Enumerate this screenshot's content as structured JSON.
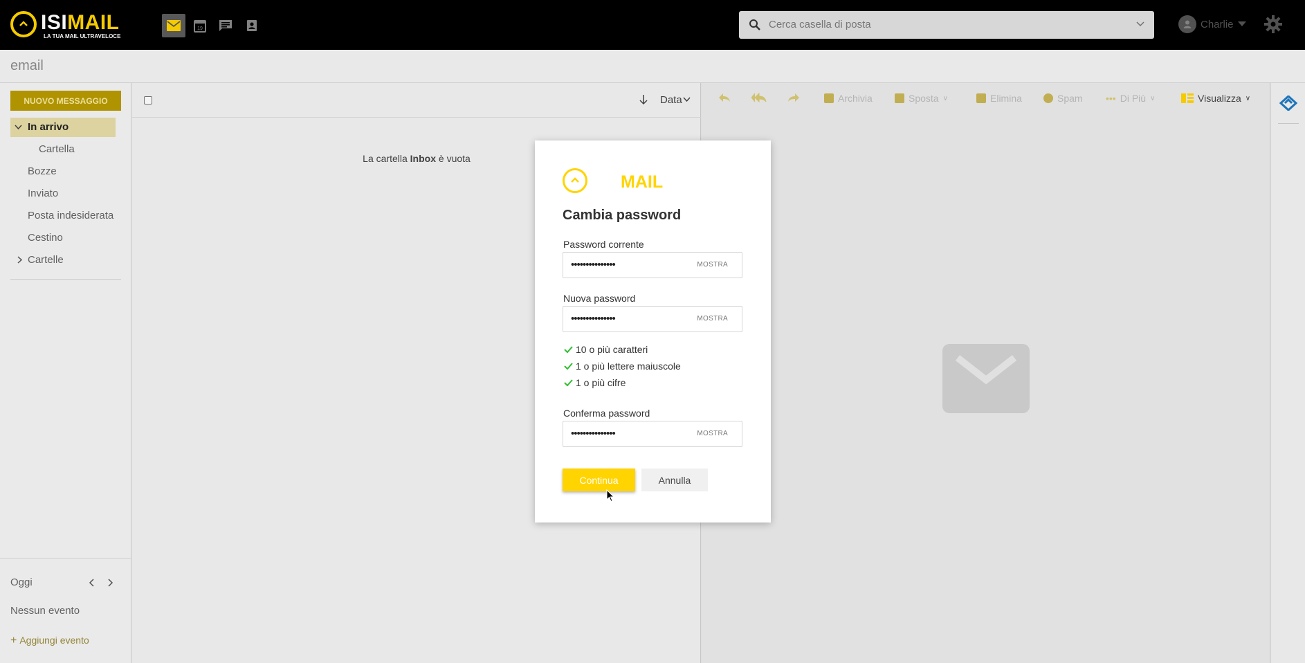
{
  "header": {
    "brand_prefix": "ISI",
    "brand_suffix": "MAIL",
    "tagline": "LA TUA MAIL ULTRAVELOCE",
    "apps": [
      "mail-icon",
      "calendar-icon",
      "chat-icon",
      "contacts-icon"
    ],
    "search": {
      "placeholder": "Cerca casella di posta"
    },
    "user_name": "Charlie"
  },
  "module": {
    "title": "email"
  },
  "sidebar": {
    "new_message_label": "NUOVO MESSAGGIO",
    "folders": [
      {
        "label": "In arrivo"
      },
      {
        "label": "Cartella"
      },
      {
        "label": "Bozze"
      },
      {
        "label": "Inviato"
      },
      {
        "label": "Posta indesiderata"
      },
      {
        "label": "Cestino"
      },
      {
        "label": "Cartelle"
      }
    ],
    "calendar": {
      "day_label": "Oggi",
      "no_events": "Nessun evento",
      "add_event": "Aggiungi evento"
    }
  },
  "list": {
    "sort_label": "Data",
    "empty_prefix": "La cartella ",
    "empty_folder": "Inbox",
    "empty_suffix": " è vuota"
  },
  "toolbar": {
    "archive": "Archivia",
    "move": "Sposta",
    "delete": "Elimina",
    "spam": "Spam",
    "more": "Di Più",
    "view": "Visualizza"
  },
  "modal": {
    "logo_text": "MAIL",
    "title": "Cambia password",
    "current_label": "Password corrente",
    "current_value": "•••••••••••••••",
    "new_label": "Nuova password",
    "new_value": "•••••••••••••••",
    "confirm_label": "Conferma password",
    "confirm_value": "•••••••••••••••",
    "show_label": "MOSTRA",
    "rules": [
      "10 o più caratteri",
      "1 o più lettere maiuscole",
      "1 o più cifre"
    ],
    "continue_label": "Continua",
    "cancel_label": "Annulla"
  },
  "colors": {
    "accent": "#ffd400",
    "topbar": "#000000",
    "rule_ok": "#2fbf2f"
  }
}
